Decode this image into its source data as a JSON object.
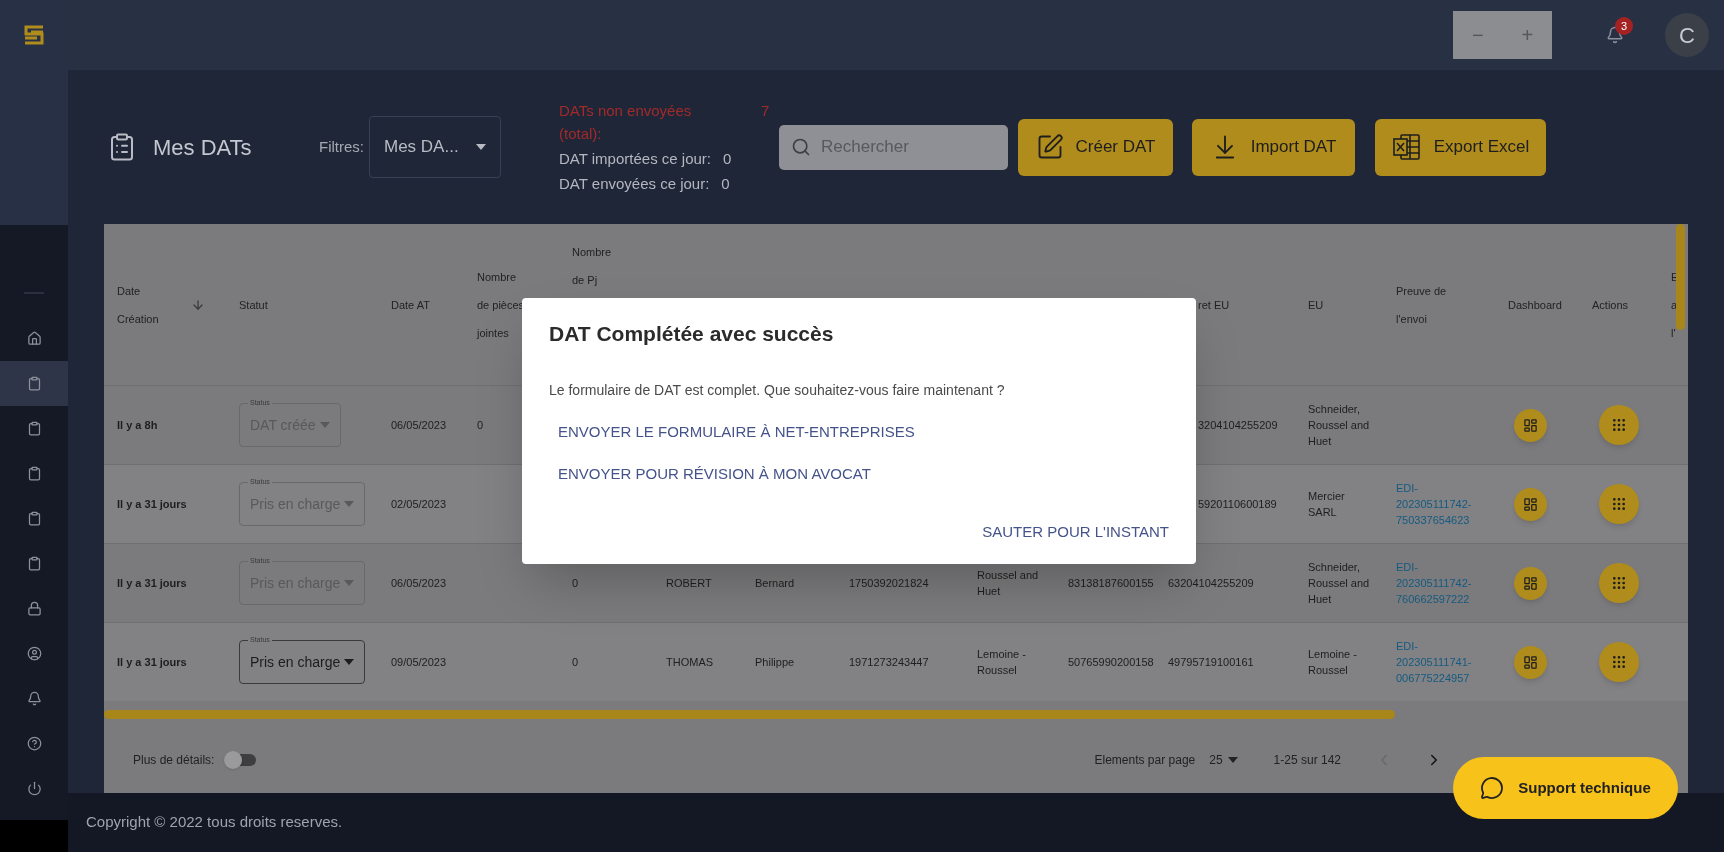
{
  "topbar": {
    "zoom_out": "−",
    "zoom_in": "+",
    "notifications": "3",
    "avatar": "C"
  },
  "sidebar": {
    "items": [
      {
        "selected": false
      },
      {
        "selected": true
      },
      {
        "selected": false
      },
      {
        "selected": false
      },
      {
        "selected": false
      },
      {
        "selected": false
      },
      {
        "selected": false
      },
      {
        "selected": false
      },
      {
        "selected": false
      },
      {
        "selected": false
      },
      {
        "selected": false
      }
    ]
  },
  "page": {
    "title": "Mes DATs",
    "filter_label": "Filtres:",
    "filter_value": "Mes DA...",
    "stats": [
      {
        "kind": "alert",
        "label": "DATs non envoyées (total):",
        "value": "7"
      },
      {
        "kind": "normal",
        "label": "DAT importées ce jour:",
        "value": "0"
      },
      {
        "kind": "normal",
        "label": "DAT envoyées ce jour:",
        "value": "0"
      }
    ],
    "search": {
      "placeholder": "Rechercher"
    },
    "buttons": [
      "Créer DAT",
      "Import DAT",
      "Export Excel"
    ]
  },
  "table": {
    "columns": [
      "Date Création",
      "Statut",
      "Date AT",
      "Nombre de pièces jointes",
      "Nombre de Pj",
      "",
      "",
      "",
      "",
      "",
      "ret EU",
      "EU",
      "Preuve de l'envoi",
      "Dashboard",
      "Actions",
      "E a l'"
    ],
    "rows": [
      {
        "created": "Il y a 8h",
        "status": {
          "label": "Status",
          "value": "DAT créée",
          "disabled": true
        },
        "date_at": "06/05/2023",
        "pieces": "0",
        "siret_eu": "3204104255209",
        "eu": "Schneider, Roussel and Huet"
      },
      {
        "created": "Il y a 31 jours",
        "status": {
          "label": "Status",
          "value": "Pris en charge",
          "disabled": true
        },
        "date_at": "02/05/2023",
        "siret_eu": "5920110600189",
        "eu": "Mercier SARL",
        "preuve": "EDI-202305111742-750337654623"
      },
      {
        "created": "Il y a 31 jours",
        "status": {
          "label": "Status",
          "value": "Pris en charge",
          "disabled": true
        },
        "date_at": "06/05/2023",
        "pj": "0",
        "nom": "ROBERT",
        "prenom": "Bernard",
        "nir": "1750392021824",
        "entreprise": "Roussel and Huet",
        "siret": "83138187600155",
        "siret_eu": "63204104255209",
        "eu": "Schneider, Roussel and Huet",
        "preuve": "EDI-202305111742-760662597222"
      },
      {
        "created": "Il y a 31 jours",
        "status": {
          "label": "Status",
          "value": "Pris en charge",
          "disabled": false
        },
        "date_at": "09/05/2023",
        "pj": "0",
        "nom": "THOMAS",
        "prenom": "Philippe",
        "nir": "1971273243447",
        "entreprise": "Lemoine - Roussel",
        "siret": "50765990200158",
        "siret_eu": "49795719100161",
        "eu": "Lemoine - Roussel",
        "preuve": "EDI-202305111741-006775224957"
      }
    ]
  },
  "table_footer": {
    "details": {
      "label": "Plus de détails:",
      "on": false
    },
    "per_page_label": "Elements par page",
    "per_page": "25",
    "range": "1-25 sur 142",
    "prev_disabled": true,
    "next_disabled": false
  },
  "dialog": {
    "title": "DAT Complétée avec succès",
    "message": "Le formulaire de DAT est complet. Que souhaitez-vous faire maintenant ?",
    "actions": [
      "ENVOYER LE FORMULAIRE À NET-ENTREPRISES",
      "ENVOYER POUR RÉVISION À MON AVOCAT"
    ],
    "dismiss": "SAUTER POUR L'INSTANT"
  },
  "support": "Support technique",
  "footer": "Copyright © 2022 tous droits reserves."
}
